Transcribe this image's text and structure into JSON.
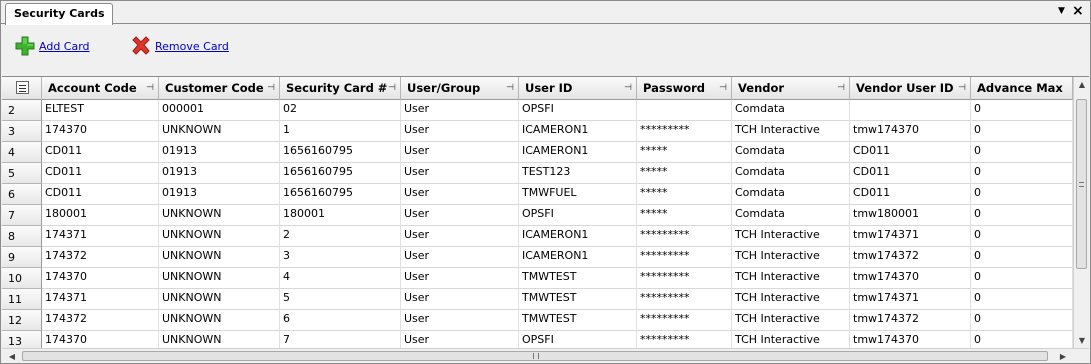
{
  "tab": {
    "title": "Security Cards",
    "menu_glyph": "▼",
    "close_glyph": "×"
  },
  "toolbar": {
    "add_label": "Add Card",
    "remove_label": "Remove Card"
  },
  "grid": {
    "columns": [
      {
        "label": "Account Code",
        "pin": "⊣"
      },
      {
        "label": "Customer Code",
        "pin": "⊣"
      },
      {
        "label": "Security Card #",
        "pin": "⊣"
      },
      {
        "label": "User/Group",
        "pin": "⊣"
      },
      {
        "label": "User ID",
        "pin": "⊣"
      },
      {
        "label": "Password",
        "pin": "⊣"
      },
      {
        "label": "Vendor",
        "pin": "⊣"
      },
      {
        "label": "Vendor User ID",
        "pin": "⊣"
      },
      {
        "label": "Advance Max",
        "pin": ""
      }
    ],
    "rows": [
      {
        "num": "2",
        "cells": [
          "ELTEST",
          "000001",
          "02",
          "User",
          "OPSFI",
          "",
          "Comdata",
          "",
          "0"
        ]
      },
      {
        "num": "3",
        "cells": [
          "174370",
          "UNKNOWN",
          "1",
          "User",
          "ICAMERON1",
          "*********",
          "TCH Interactive",
          "tmw174370",
          "0"
        ]
      },
      {
        "num": "4",
        "cells": [
          "CD011",
          "01913",
          "1656160795",
          "User",
          "ICAMERON1",
          "*****",
          "Comdata",
          "CD011",
          "0"
        ]
      },
      {
        "num": "5",
        "cells": [
          "CD011",
          "01913",
          "1656160795",
          "User",
          "TEST123",
          "*****",
          "Comdata",
          "CD011",
          "0"
        ]
      },
      {
        "num": "6",
        "cells": [
          "CD011",
          "01913",
          "1656160795",
          "User",
          "TMWFUEL",
          "*****",
          "Comdata",
          "CD011",
          "0"
        ]
      },
      {
        "num": "7",
        "cells": [
          "180001",
          "UNKNOWN",
          "180001",
          "User",
          "OPSFI",
          "*****",
          "Comdata",
          "tmw180001",
          "0"
        ]
      },
      {
        "num": "8",
        "cells": [
          "174371",
          "UNKNOWN",
          "2",
          "User",
          "ICAMERON1",
          "*********",
          "TCH Interactive",
          "tmw174371",
          "0"
        ]
      },
      {
        "num": "9",
        "cells": [
          "174372",
          "UNKNOWN",
          "3",
          "User",
          "ICAMERON1",
          "*********",
          "TCH Interactive",
          "tmw174372",
          "0"
        ]
      },
      {
        "num": "10",
        "cells": [
          "174370",
          "UNKNOWN",
          "4",
          "User",
          "TMWTEST",
          "*********",
          "TCH Interactive",
          "tmw174370",
          "0"
        ]
      },
      {
        "num": "11",
        "cells": [
          "174371",
          "UNKNOWN",
          "5",
          "User",
          "TMWTEST",
          "*********",
          "TCH Interactive",
          "tmw174371",
          "0"
        ]
      },
      {
        "num": "12",
        "cells": [
          "174372",
          "UNKNOWN",
          "6",
          "User",
          "TMWTEST",
          "*********",
          "TCH Interactive",
          "tmw174372",
          "0"
        ]
      },
      {
        "num": "13",
        "cells": [
          "174370",
          "UNKNOWN",
          "7",
          "User",
          "OPSFI",
          "*********",
          "TCH Interactive",
          "tmw174370",
          "0"
        ]
      }
    ]
  },
  "scroll": {
    "up": "▲",
    "down": "▼",
    "left": "◀",
    "right": "▶"
  },
  "colors": {
    "link": "#0000cc",
    "add_icon": "#3cb22e",
    "remove_icon": "#e0342b"
  }
}
